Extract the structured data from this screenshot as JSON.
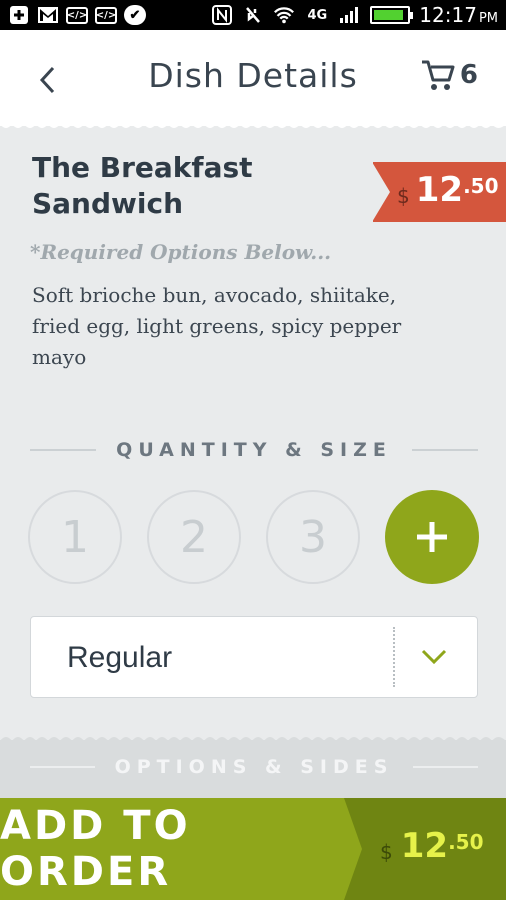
{
  "status_bar": {
    "time": "12:17",
    "ampm": "PM",
    "network": "4G",
    "battery_level": 0.9
  },
  "header": {
    "title": "Dish Details",
    "cart_count": "6",
    "back_icon": "chevron-left-icon",
    "cart_icon": "cart-icon"
  },
  "dish": {
    "name": "The Breakfast Sandwich",
    "price_currency": "$",
    "price_dollars": "12",
    "price_cents": ".50",
    "required_note": "*Required Options Below...",
    "description": "Soft brioche bun, avocado, shiitake, fried egg, light greens, spicy pepper mayo"
  },
  "quantity_section": {
    "label": "QUANTITY & SIZE",
    "options": [
      "1",
      "2",
      "3"
    ],
    "plus_icon": "plus-icon"
  },
  "size_select": {
    "value": "Regular",
    "chevron_icon": "chevron-down-icon"
  },
  "options_section": {
    "label": "OPTIONS & SIDES"
  },
  "footer": {
    "add_label": "ADD TO ORDER",
    "price_currency": "$",
    "price_dollars": "12",
    "price_cents": ".50"
  },
  "colors": {
    "accent_green": "#8fa61b",
    "price_red": "#d4563d",
    "text_dark": "#2f3b46"
  }
}
